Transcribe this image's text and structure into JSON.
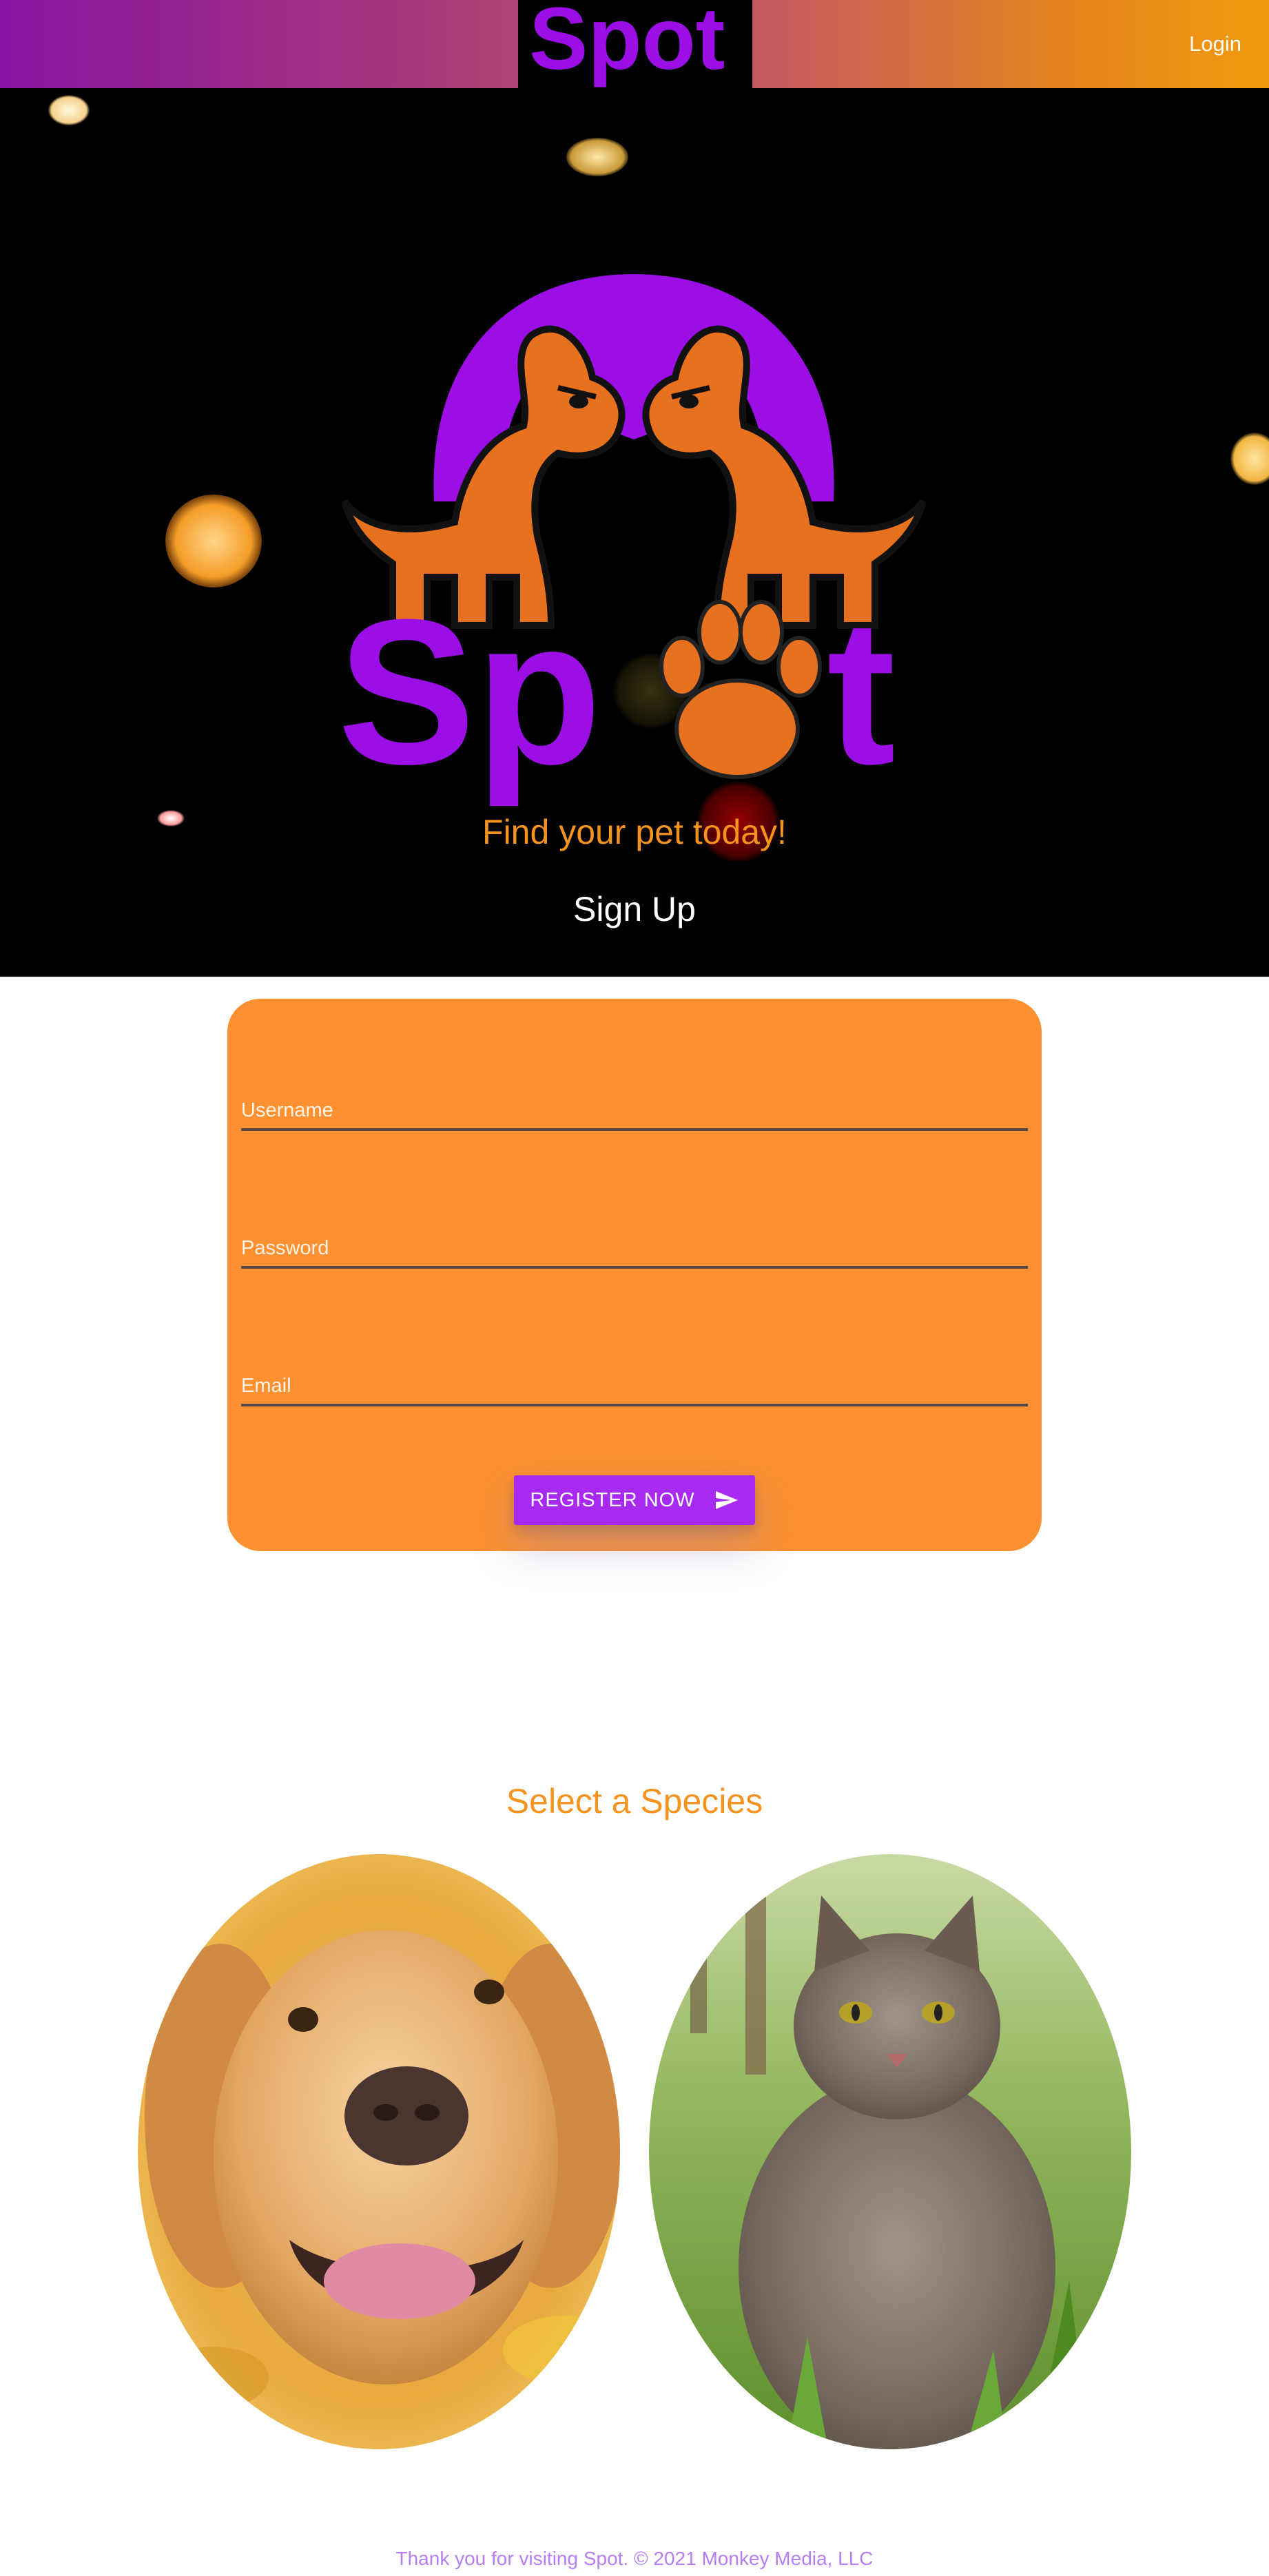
{
  "nav": {
    "brand": "Spot",
    "login_label": "Login"
  },
  "hero": {
    "brand": "Spot",
    "tagline": "Find your pet today!",
    "signup_heading": "Sign Up"
  },
  "form": {
    "username_placeholder": "Username",
    "password_placeholder": "Password",
    "email_placeholder": "Email",
    "register_label": "REGISTER NOW"
  },
  "species": {
    "heading": "Select a Species",
    "options": [
      {
        "name": "dog",
        "icon": "dog-photo"
      },
      {
        "name": "cat",
        "icon": "cat-photo"
      }
    ]
  },
  "footer": {
    "text": "Thank you for visiting Spot. © 2021 Monkey Media, LLC"
  },
  "colors": {
    "brand_purple": "#9b0ee6",
    "brand_orange": "#e8711f",
    "form_orange": "#fd9131",
    "button_purple": "#a829f1",
    "heading_orange": "#f5931e",
    "footer_purple": "#b57ef3"
  }
}
